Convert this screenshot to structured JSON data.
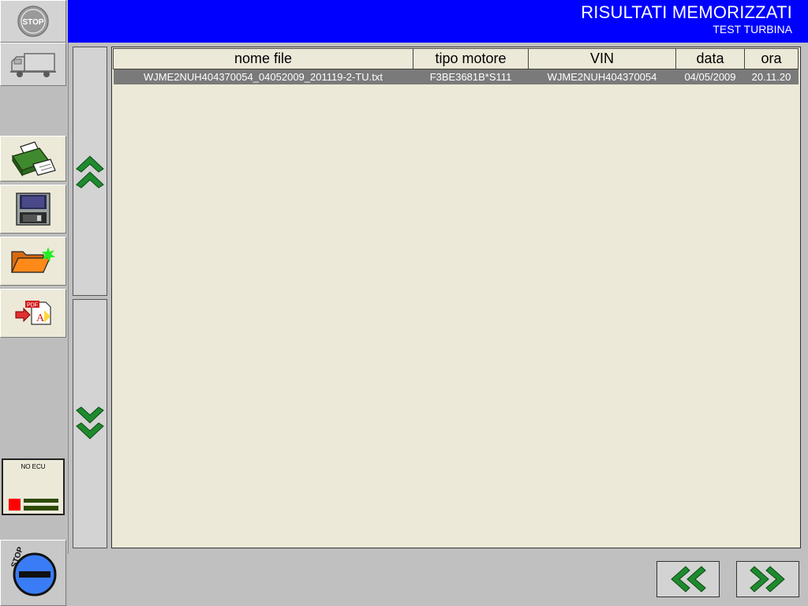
{
  "header": {
    "title": "RISULTATI MEMORIZZATI",
    "subtitle": "TEST TURBINA"
  },
  "sidebar": {
    "stop_top_label": "STOP",
    "ecu_status": "NO ECU",
    "stop_bottom_label": "STOP"
  },
  "table": {
    "columns": [
      "nome file",
      "tipo motore",
      "VIN",
      "data",
      "ora"
    ],
    "rows": [
      [
        "WJME2NUH404370054_04052009_201119-2-TU.txt",
        "F3BE3681B*S111",
        "WJME2NUH404370054",
        "04/05/2009",
        "20.11.20"
      ]
    ]
  },
  "icons": {
    "stop_top": "stop-sign-icon",
    "truck": "truck-icon",
    "printer": "printer-icon",
    "save": "floppy-disk-icon",
    "open": "folder-open-icon",
    "pdf": "pdf-export-icon",
    "scroll_up": "double-chevron-up-icon",
    "scroll_down": "double-chevron-down-icon",
    "prev": "double-chevron-left-icon",
    "next": "double-chevron-right-icon",
    "stop_bottom": "stop-button-icon"
  },
  "colors": {
    "header": "#0000ff",
    "panel": "#ece9d8",
    "arrow": "#1e8a2e",
    "selected_row": "#7a7a7a",
    "ecu_red": "#ff0000",
    "ecu_green": "#2d4a00"
  }
}
